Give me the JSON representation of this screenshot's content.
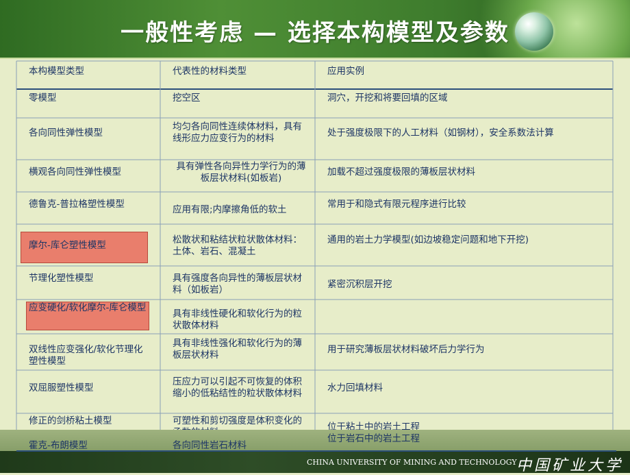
{
  "title": "一般性考虑 — 选择本构模型及参数",
  "table": {
    "headers": [
      "本构模型类型",
      "代表性的材料类型",
      "应用实例"
    ],
    "rows": [
      [
        "零模型",
        "挖空区",
        "洞穴，开挖和将要回填的区域"
      ],
      [
        "各向同性弹性模型",
        "均匀各向同性连续体材料，具有线形应力应变行为的材料",
        "处于强度极限下的人工材料（如钢材），安全系数法计算"
      ],
      [
        "横观各向同性弹性模型",
        "具有弹性各向异性力学行为的薄板层状材料(如板岩)",
        "加载不超过强度极限的薄板层状材料"
      ],
      [
        "德鲁克-普拉格塑性模型",
        "应用有限;内摩擦角低的软土",
        "常用于和隐式有限元程序进行比较"
      ],
      [
        "摩尔-库仑塑性模型",
        "松散状和粘结状粒状散体材料：土体、岩石、混凝土",
        "通用的岩土力学模型(如边坡稳定问题和地下开挖)"
      ],
      [
        "节理化塑性模型",
        "具有强度各向异性的薄板层状材料（如板岩）",
        "紧密沉积层开挖"
      ],
      [
        "应变硬化/软化摩尔-库仑模型",
        "具有非线性硬化和软化行为的粒状散体材料",
        ""
      ],
      [
        "双线性应变强化/软化节理化塑性模型",
        "具有非线性强化和软化行为的薄板层状材料",
        "用于研究薄板层状材料破坏后力学行为"
      ],
      [
        "双屈服塑性模型",
        "压应力可以引起不可恢复的体积缩小的低粘结性的粒状散体材料",
        "水力回填材料"
      ],
      [
        "修正的剑桥粘土模型",
        "可塑性和剪切强度是体积变化的函数的材料",
        "位于粘土中的岩土工程"
      ],
      [
        "霍克-布朗模型",
        "各向同性岩石材料",
        "位于岩石中的岩土工程"
      ]
    ]
  },
  "footer": {
    "university_en": "CHINA UNIVERSITY OF MINING AND TECHNOLOGY",
    "university_cn": "中国矿业大学"
  },
  "colors": {
    "highlight": "#e97e6c",
    "text": "#1d3565",
    "background": "#e7edc9"
  }
}
